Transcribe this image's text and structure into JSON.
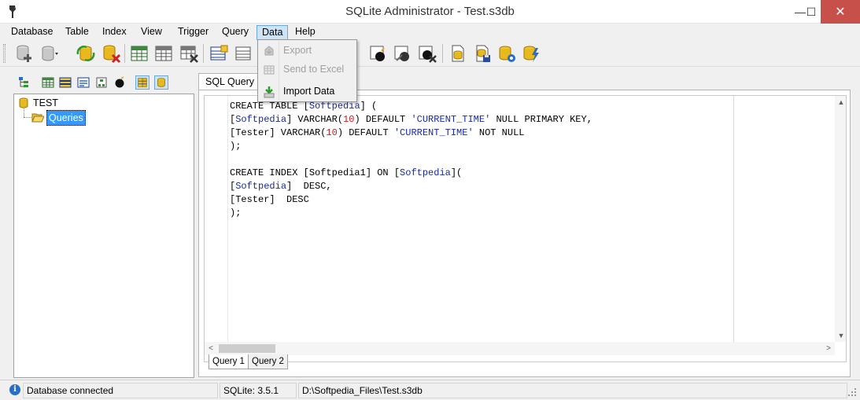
{
  "window": {
    "title": "SQLite Administrator - Test.s3db",
    "minimize_glyph": "—",
    "maximize_glyph": "☐",
    "close_glyph": "✕"
  },
  "menu": {
    "items": [
      "Database",
      "Table",
      "Index",
      "View",
      "Trigger",
      "Query",
      "Data",
      "Help"
    ],
    "open_item": "Data"
  },
  "data_menu": {
    "items": [
      {
        "label": "Export",
        "enabled": false,
        "icon": "export-icon"
      },
      {
        "label": "Send to Excel",
        "enabled": false,
        "icon": "excel-grid-icon"
      },
      {
        "label": "Import Data",
        "enabled": true,
        "icon": "import-icon"
      }
    ]
  },
  "tree": {
    "root": "TEST",
    "child": "Queries"
  },
  "editor": {
    "tab": "SQL Query",
    "lines": [
      [
        {
          "t": "CREATE ",
          "c": ""
        },
        {
          "t": "TABLE ",
          "c": ""
        },
        {
          "t": "[",
          "c": ""
        },
        {
          "t": "Softpedia",
          "c": "blue"
        },
        {
          "t": "] (",
          "c": ""
        }
      ],
      [
        {
          "t": "[",
          "c": ""
        },
        {
          "t": "Softpedia",
          "c": "blue"
        },
        {
          "t": "] VARCHAR(",
          "c": ""
        },
        {
          "t": "10",
          "c": "red"
        },
        {
          "t": ") DEFAULT ",
          "c": ""
        },
        {
          "t": "'CURRENT_TIME'",
          "c": "str"
        },
        {
          "t": " NULL PRIMARY KEY,",
          "c": ""
        }
      ],
      [
        {
          "t": "[Tester] VARCHAR(",
          "c": ""
        },
        {
          "t": "10",
          "c": "red"
        },
        {
          "t": ") DEFAULT ",
          "c": ""
        },
        {
          "t": "'CURRENT_TIME'",
          "c": "str"
        },
        {
          "t": " NOT NULL",
          "c": ""
        }
      ],
      [
        {
          "t": ");",
          "c": ""
        }
      ],
      [
        {
          "t": "",
          "c": ""
        }
      ],
      [
        {
          "t": "CREATE INDEX [Softpedia1] ON [",
          "c": ""
        },
        {
          "t": "Softpedia",
          "c": "blue"
        },
        {
          "t": "](",
          "c": ""
        }
      ],
      [
        {
          "t": "[",
          "c": ""
        },
        {
          "t": "Softpedia",
          "c": "blue"
        },
        {
          "t": "]  DESC,",
          "c": ""
        }
      ],
      [
        {
          "t": "[Tester]  DESC",
          "c": ""
        }
      ],
      [
        {
          "t": ");",
          "c": ""
        }
      ]
    ],
    "query_tabs": [
      "Query 1",
      "Query 2"
    ],
    "active_query_tab": "Query 1"
  },
  "status": {
    "message": "Database connected",
    "version": "SQLite: 3.5.1",
    "path": "D:\\Softpedia_Files\\Test.s3db"
  },
  "colors": {
    "keyword_blue": "#1a2a9b",
    "number_red": "#c81e1e",
    "close_button": "#c7504a",
    "selection": "#3399ff"
  }
}
